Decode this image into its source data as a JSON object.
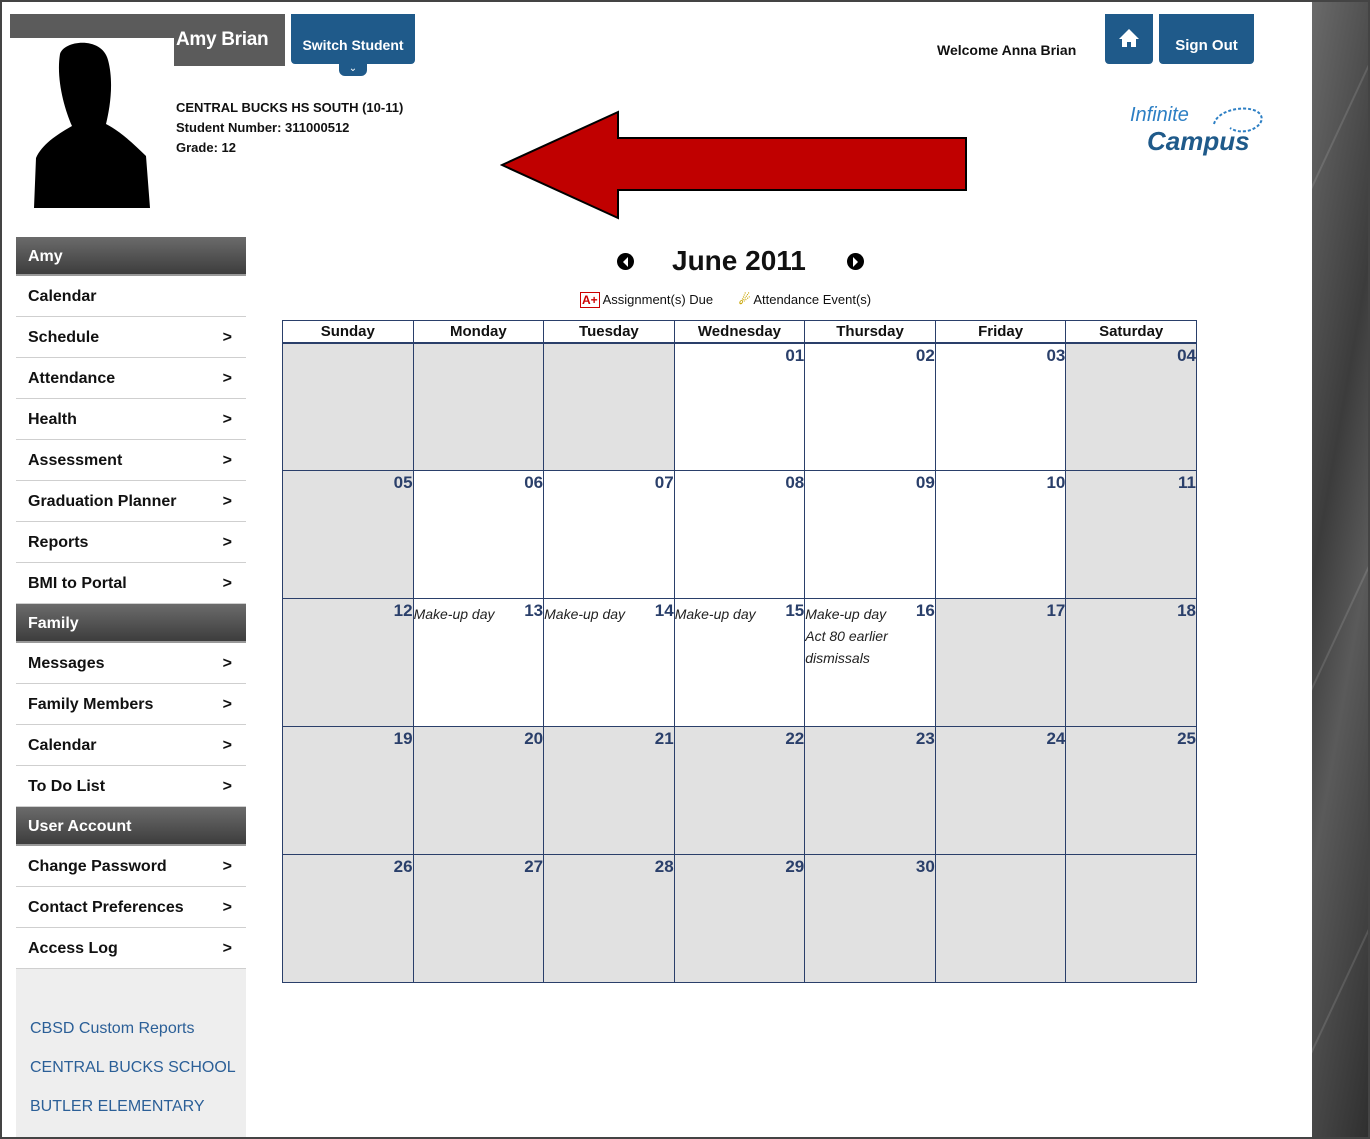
{
  "header": {
    "student_name": "Amy Brian",
    "switch_student": "Switch Student",
    "school": "CENTRAL BUCKS HS SOUTH (10-11)",
    "student_number": "Student Number: 311000512",
    "grade": "Grade: 12",
    "welcome": "Welcome Anna Brian",
    "home_icon": "home-icon",
    "sign_out": "Sign Out",
    "logo_line1": "Infinite",
    "logo_line2": "Campus"
  },
  "sidebar": {
    "section_amy": "Amy",
    "amy_items": [
      {
        "label": "Calendar"
      },
      {
        "label": "Schedule"
      },
      {
        "label": "Attendance"
      },
      {
        "label": "Health"
      },
      {
        "label": "Assessment"
      },
      {
        "label": "Graduation Planner"
      },
      {
        "label": "Reports"
      },
      {
        "label": "BMI to Portal"
      }
    ],
    "section_family": "Family",
    "family_items": [
      {
        "label": "Messages"
      },
      {
        "label": "Family Members"
      },
      {
        "label": "Calendar"
      },
      {
        "label": "To Do List"
      }
    ],
    "section_account": "User Account",
    "account_items": [
      {
        "label": "Change Password"
      },
      {
        "label": "Contact Preferences"
      },
      {
        "label": "Access Log"
      }
    ],
    "links": [
      "CBSD Custom Reports",
      "CENTRAL BUCKS SCHOOL",
      "BUTLER ELEMENTARY"
    ],
    "chevron": ">"
  },
  "calendar": {
    "month_title": "June 2011",
    "legend_assign_icon": "A+",
    "legend_assignments": "Assignment(s) Due",
    "legend_attend_icon": "☄",
    "legend_attendance": "Attendance Event(s)",
    "days": [
      "Sunday",
      "Monday",
      "Tuesday",
      "Wednesday",
      "Thursday",
      "Friday",
      "Saturday"
    ],
    "weeks": [
      [
        {
          "num": "",
          "off": true,
          "evt": ""
        },
        {
          "num": "",
          "off": true,
          "evt": ""
        },
        {
          "num": "",
          "off": true,
          "evt": ""
        },
        {
          "num": "01",
          "off": false,
          "evt": ""
        },
        {
          "num": "02",
          "off": false,
          "evt": ""
        },
        {
          "num": "03",
          "off": false,
          "evt": ""
        },
        {
          "num": "04",
          "off": true,
          "evt": ""
        }
      ],
      [
        {
          "num": "05",
          "off": true,
          "evt": ""
        },
        {
          "num": "06",
          "off": false,
          "evt": ""
        },
        {
          "num": "07",
          "off": false,
          "evt": ""
        },
        {
          "num": "08",
          "off": false,
          "evt": ""
        },
        {
          "num": "09",
          "off": false,
          "evt": ""
        },
        {
          "num": "10",
          "off": false,
          "evt": ""
        },
        {
          "num": "11",
          "off": true,
          "evt": ""
        }
      ],
      [
        {
          "num": "12",
          "off": true,
          "evt": ""
        },
        {
          "num": "13",
          "off": false,
          "evt": "Make-up day"
        },
        {
          "num": "14",
          "off": false,
          "evt": "Make-up day"
        },
        {
          "num": "15",
          "off": false,
          "evt": "Make-up day"
        },
        {
          "num": "16",
          "off": false,
          "evt": "Make-up day\nAct 80 earlier dismissals"
        },
        {
          "num": "17",
          "off": true,
          "evt": ""
        },
        {
          "num": "18",
          "off": true,
          "evt": ""
        }
      ],
      [
        {
          "num": "19",
          "off": true,
          "evt": ""
        },
        {
          "num": "20",
          "off": true,
          "evt": ""
        },
        {
          "num": "21",
          "off": true,
          "evt": ""
        },
        {
          "num": "22",
          "off": true,
          "evt": ""
        },
        {
          "num": "23",
          "off": true,
          "evt": ""
        },
        {
          "num": "24",
          "off": true,
          "evt": ""
        },
        {
          "num": "25",
          "off": true,
          "evt": ""
        }
      ],
      [
        {
          "num": "26",
          "off": true,
          "evt": ""
        },
        {
          "num": "27",
          "off": true,
          "evt": ""
        },
        {
          "num": "28",
          "off": true,
          "evt": ""
        },
        {
          "num": "29",
          "off": true,
          "evt": ""
        },
        {
          "num": "30",
          "off": true,
          "evt": ""
        },
        {
          "num": "",
          "off": true,
          "evt": ""
        },
        {
          "num": "",
          "off": true,
          "evt": ""
        }
      ]
    ]
  },
  "colors": {
    "accent": "#1f5a8a",
    "arrow": "#c00000"
  }
}
